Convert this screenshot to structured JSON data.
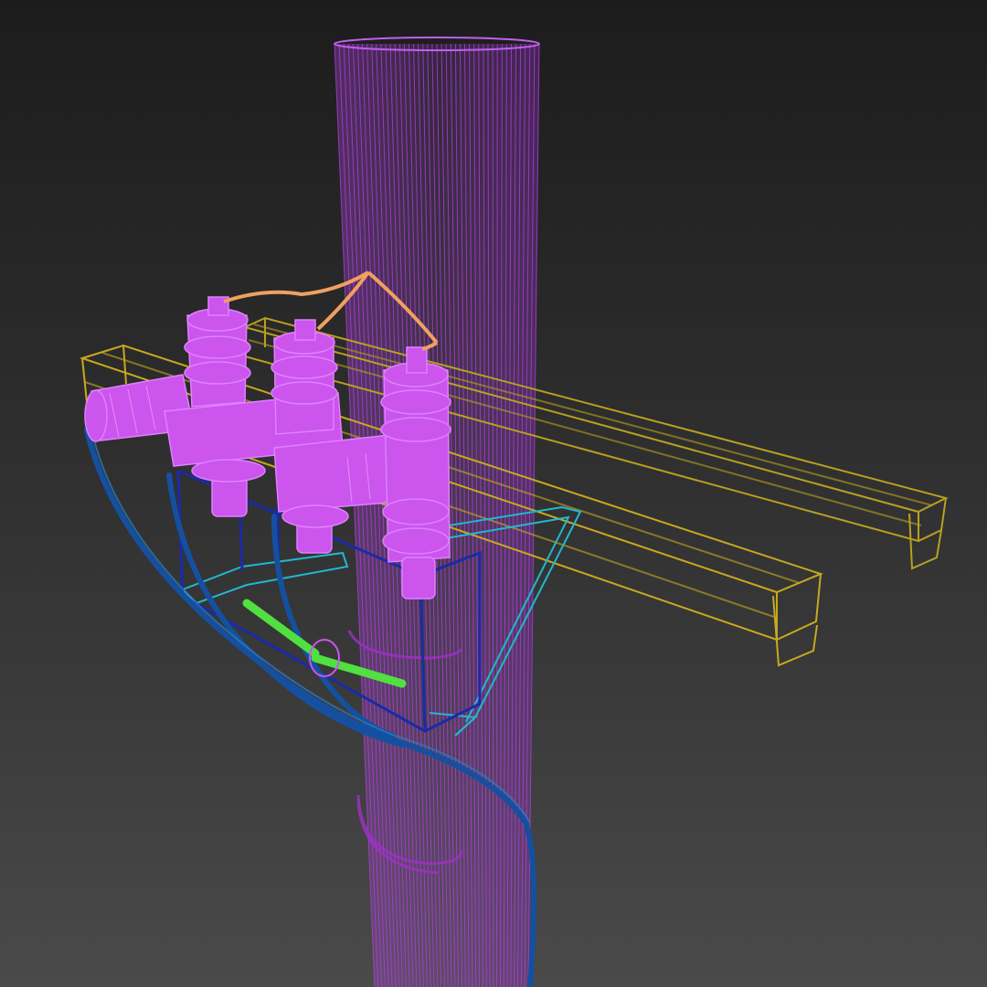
{
  "viewport": {
    "render_mode": "wireframe",
    "background": {
      "top": "#1c1c1c",
      "bottom": "#4a4a4a"
    }
  },
  "objects": [
    {
      "name": "utility-pole",
      "color": "#b040e0"
    },
    {
      "name": "pole-clamp",
      "color": "#a030c8"
    },
    {
      "name": "crossarm-upper",
      "color": "#b8a020"
    },
    {
      "name": "crossarm-lower",
      "color": "#c8a820"
    },
    {
      "name": "insulator-cluster",
      "color": "#cc55ee"
    },
    {
      "name": "mounting-frame",
      "color": "#1a2aa8"
    },
    {
      "name": "support-brace",
      "color": "#20b8d0"
    },
    {
      "name": "conductor-cable",
      "color": "#1550a0"
    },
    {
      "name": "jumper-wire",
      "color": "#f0a060"
    },
    {
      "name": "ground-rod",
      "color": "#50e040"
    }
  ]
}
